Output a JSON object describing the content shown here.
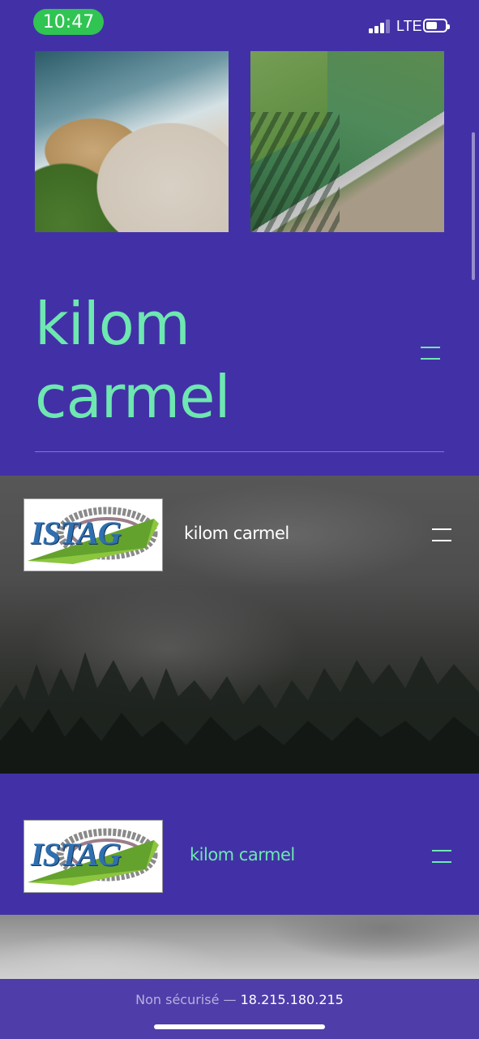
{
  "status_bar": {
    "time": "10:47",
    "network": "LTE",
    "signal_bars": 3,
    "battery_level": 0.45
  },
  "gallery": {
    "items": [
      {
        "name": "aerial-coast-photo"
      },
      {
        "name": "aerial-field-photo"
      }
    ]
  },
  "hero": {
    "title_line1": "kilom",
    "title_line2": "carmel"
  },
  "header_dark": {
    "logo_text": "ISTAG",
    "site_name": "kilom carmel"
  },
  "header_purple": {
    "logo_text": "ISTAG",
    "site_name": "kilom carmel"
  },
  "browser": {
    "security_label": "Non sécurisé",
    "separator": "—",
    "host": "18.215.180.215"
  },
  "colors": {
    "background": "#4231a6",
    "accent": "#6ee7b1",
    "status_pill": "#30c452"
  }
}
